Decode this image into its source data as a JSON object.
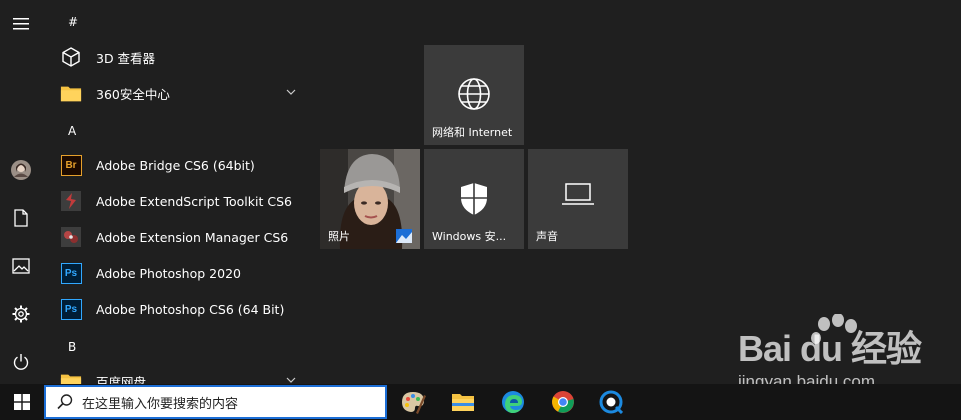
{
  "app_list": {
    "groups": [
      {
        "letter": "#"
      },
      {
        "letter": "A"
      },
      {
        "letter": "B"
      }
    ],
    "items": [
      {
        "label": "3D 查看器",
        "icon": "cube-icon"
      },
      {
        "label": "360安全中心",
        "icon": "folder-icon",
        "expandable": true
      },
      {
        "label": "Adobe Bridge CS6 (64bit)",
        "icon": "bridge-icon",
        "badge": "Br"
      },
      {
        "label": "Adobe ExtendScript Toolkit CS6",
        "icon": "extendscript-icon"
      },
      {
        "label": "Adobe Extension Manager CS6",
        "icon": "extension-manager-icon"
      },
      {
        "label": "Adobe Photoshop 2020",
        "icon": "photoshop-icon",
        "badge": "Ps"
      },
      {
        "label": "Adobe Photoshop CS6 (64 Bit)",
        "icon": "photoshop-icon",
        "badge": "Ps"
      },
      {
        "label": "百度网盘",
        "icon": "folder-icon",
        "expandable": true
      }
    ]
  },
  "tiles": [
    {
      "label": "网络和 Internet",
      "icon": "globe-icon"
    },
    {
      "label": "照片",
      "icon": "photos-icon"
    },
    {
      "label": "Windows 安...",
      "icon": "shield-icon"
    },
    {
      "label": "声音",
      "icon": "laptop-icon"
    }
  ],
  "taskbar": {
    "search_placeholder": "在这里输入你要搜索的内容",
    "apps": [
      "paint-icon",
      "file-explorer-icon",
      "edge-icon",
      "chrome-icon",
      "quicklook-icon"
    ]
  },
  "watermark": {
    "title": "Bai du 经验",
    "subtitle": "jingyan.baidu.com"
  },
  "colors": {
    "background": "#1f1f1f",
    "tile": "#3b3b3b",
    "taskbar": "#141414",
    "search_border": "#1c6ed6",
    "folder": "#f5c242",
    "photoshop": "#31a8ff",
    "bridge": "#e6a02b"
  }
}
